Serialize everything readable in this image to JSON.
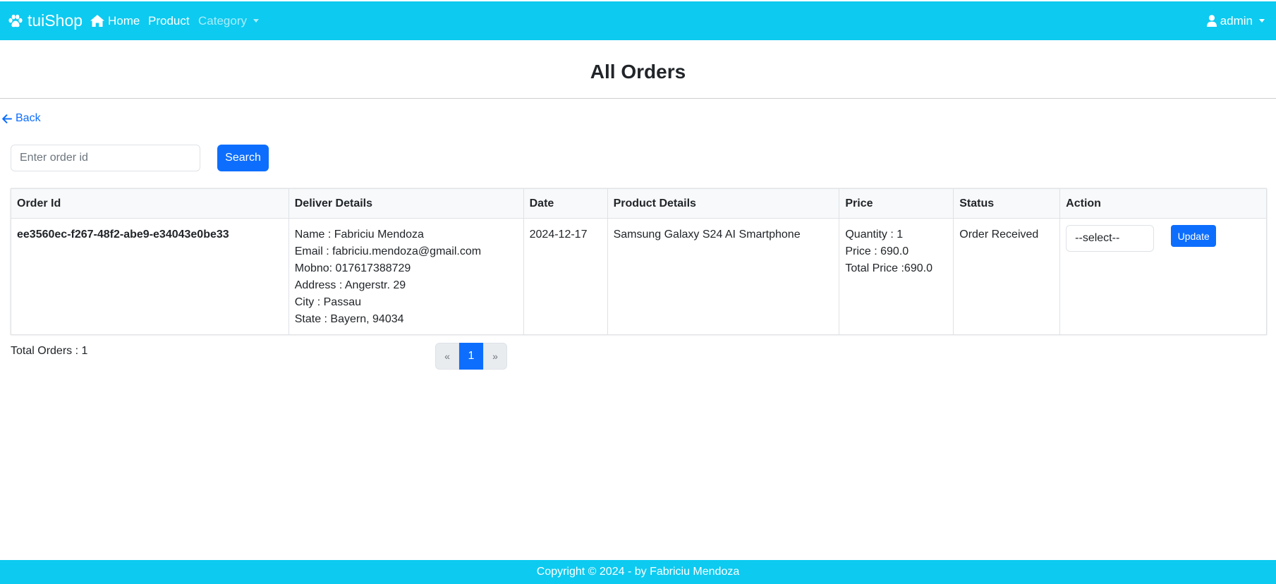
{
  "navbar": {
    "brand": "tuiShop",
    "home": "Home",
    "product": "Product",
    "category": "Category",
    "user": "admin"
  },
  "page": {
    "title": "All Orders",
    "back": "Back"
  },
  "search": {
    "placeholder": "Enter order id",
    "button": "Search"
  },
  "table": {
    "headers": [
      "Order Id",
      "Deliver Details",
      "Date",
      "Product Details",
      "Price",
      "Status",
      "Action"
    ],
    "rows": [
      {
        "order_id": "ee3560ec-f267-48f2-abe9-e34043e0be33",
        "deliver": {
          "name": "Name : Fabriciu Mendoza",
          "email": "Email : fabriciu.mendoza@gmail.com",
          "mobno": "Mobno: 017617388729",
          "address": "Address : Angerstr. 29",
          "city": "City : Passau",
          "state": "State : Bayern, 94034"
        },
        "date": "2024-12-17",
        "product": "Samsung Galaxy S24 AI Smartphone",
        "price": {
          "quantity": "Quantity : 1",
          "price": "Price : 690.0",
          "total": "Total Price :690.0"
        },
        "status": "Order Received",
        "action": {
          "select_value": "--select--",
          "update": "Update"
        }
      }
    ]
  },
  "summary": {
    "total_orders": "Total Orders : 1"
  },
  "pagination": {
    "prev": "«",
    "current": "1",
    "next": "»"
  },
  "footer": {
    "copyright": "Copyright © 2024 - by Fabriciu Mendoza"
  },
  "colors": {
    "navbar": "#0dcaf0",
    "primary": "#0d6efd",
    "header_bg": "#f8f9fa"
  },
  "icons": {
    "brand": "paw-icon",
    "home": "home-icon",
    "user": "user-icon",
    "back": "arrow-left-icon"
  }
}
